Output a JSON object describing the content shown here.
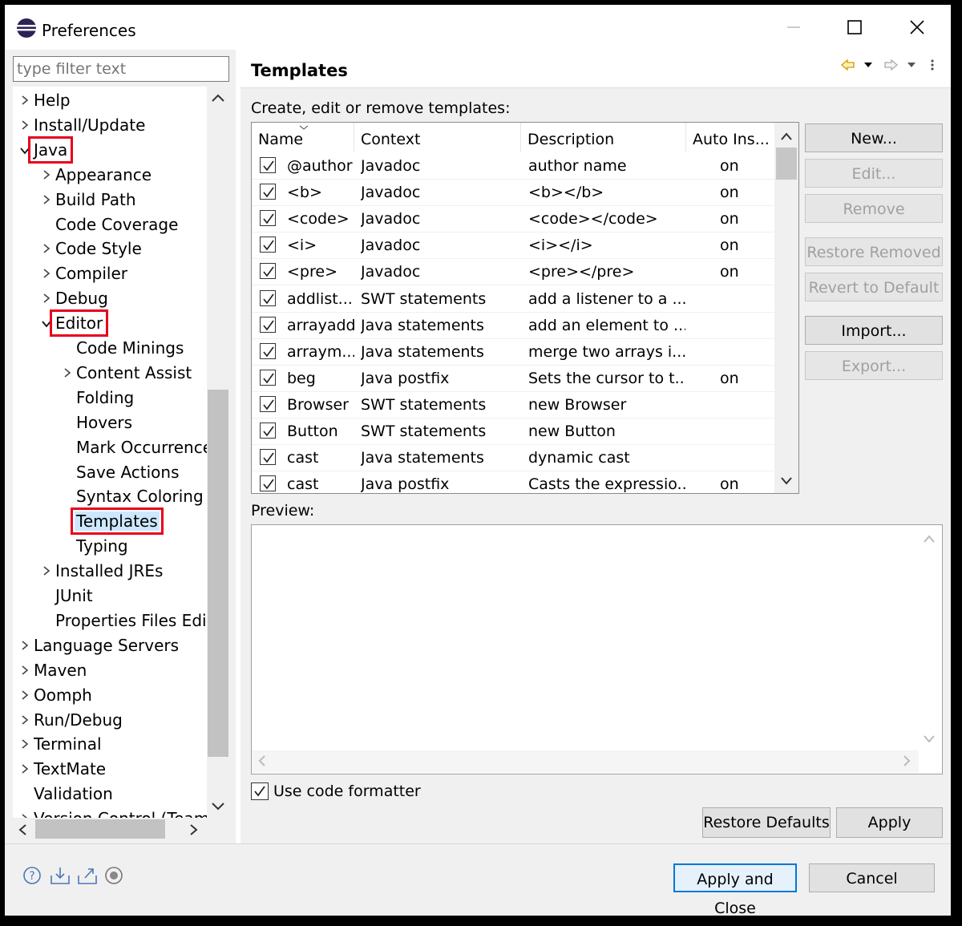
{
  "window": {
    "title": "Preferences"
  },
  "filter": {
    "placeholder": "type filter text"
  },
  "tree": [
    {
      "label": "Help",
      "level": 0,
      "arrow": ">"
    },
    {
      "label": "Install/Update",
      "level": 0,
      "arrow": ">"
    },
    {
      "label": "Java",
      "level": 0,
      "arrow": "v",
      "highlight": true
    },
    {
      "label": "Appearance",
      "level": 1,
      "arrow": ">"
    },
    {
      "label": "Build Path",
      "level": 1,
      "arrow": ">"
    },
    {
      "label": "Code Coverage",
      "level": 1,
      "arrow": ""
    },
    {
      "label": "Code Style",
      "level": 1,
      "arrow": ">"
    },
    {
      "label": "Compiler",
      "level": 1,
      "arrow": ">"
    },
    {
      "label": "Debug",
      "level": 1,
      "arrow": ">"
    },
    {
      "label": "Editor",
      "level": 1,
      "arrow": "v",
      "highlight": true
    },
    {
      "label": "Code Minings",
      "level": 2,
      "arrow": ""
    },
    {
      "label": "Content Assist",
      "level": 2,
      "arrow": ">"
    },
    {
      "label": "Folding",
      "level": 2,
      "arrow": ""
    },
    {
      "label": "Hovers",
      "level": 2,
      "arrow": ""
    },
    {
      "label": "Mark Occurrences",
      "level": 2,
      "arrow": ""
    },
    {
      "label": "Save Actions",
      "level": 2,
      "arrow": ""
    },
    {
      "label": "Syntax Coloring",
      "level": 2,
      "arrow": ""
    },
    {
      "label": "Templates",
      "level": 2,
      "arrow": "",
      "highlight": true,
      "selected": true
    },
    {
      "label": "Typing",
      "level": 2,
      "arrow": ""
    },
    {
      "label": "Installed JREs",
      "level": 1,
      "arrow": ">"
    },
    {
      "label": "JUnit",
      "level": 1,
      "arrow": ""
    },
    {
      "label": "Properties Files Editor",
      "level": 1,
      "arrow": ""
    },
    {
      "label": "Language Servers",
      "level": 0,
      "arrow": ">"
    },
    {
      "label": "Maven",
      "level": 0,
      "arrow": ">"
    },
    {
      "label": "Oomph",
      "level": 0,
      "arrow": ">"
    },
    {
      "label": "Run/Debug",
      "level": 0,
      "arrow": ">"
    },
    {
      "label": "Terminal",
      "level": 0,
      "arrow": ">"
    },
    {
      "label": "TextMate",
      "level": 0,
      "arrow": ">"
    },
    {
      "label": "Validation",
      "level": 0,
      "arrow": ""
    },
    {
      "label": "Version Control (Team)",
      "level": 0,
      "arrow": ">"
    }
  ],
  "main": {
    "title": "Templates",
    "description": "Create, edit or remove templates:",
    "columns": [
      "Name",
      "Context",
      "Description",
      "Auto Ins..."
    ],
    "rows": [
      {
        "name": "@author",
        "context": "Javadoc",
        "description": "author name",
        "auto": "on"
      },
      {
        "name": "<b>",
        "context": "Javadoc",
        "description": "<b></b>",
        "auto": "on"
      },
      {
        "name": "<code>",
        "context": "Javadoc",
        "description": "<code></code>",
        "auto": "on"
      },
      {
        "name": "<i>",
        "context": "Javadoc",
        "description": "<i></i>",
        "auto": "on"
      },
      {
        "name": "<pre>",
        "context": "Javadoc",
        "description": "<pre></pre>",
        "auto": "on"
      },
      {
        "name": "addlist...",
        "context": "SWT statements",
        "description": "add a listener to a ...",
        "auto": ""
      },
      {
        "name": "arrayadd",
        "context": "Java statements",
        "description": "add an element to ...",
        "auto": ""
      },
      {
        "name": "arraym...",
        "context": "Java statements",
        "description": "merge two arrays i...",
        "auto": ""
      },
      {
        "name": "beg",
        "context": "Java postfix",
        "description": "Sets the cursor to t...",
        "auto": "on"
      },
      {
        "name": "Browser",
        "context": "SWT statements",
        "description": "new Browser",
        "auto": ""
      },
      {
        "name": "Button",
        "context": "SWT statements",
        "description": "new Button",
        "auto": ""
      },
      {
        "name": "cast",
        "context": "Java statements",
        "description": "dynamic cast",
        "auto": ""
      },
      {
        "name": "cast",
        "context": "Java postfix",
        "description": "Casts the expressio...",
        "auto": "on"
      }
    ],
    "buttons": {
      "new": "New...",
      "edit": "Edit...",
      "remove": "Remove",
      "restore_removed": "Restore Removed",
      "revert": "Revert to Default",
      "import": "Import...",
      "export": "Export..."
    },
    "preview_label": "Preview:",
    "use_formatter": "Use code formatter",
    "restore_defaults": "Restore Defaults",
    "apply": "Apply"
  },
  "footer": {
    "apply_close": "Apply and Close",
    "cancel": "Cancel"
  },
  "colors": {
    "highlight": "#e8001c",
    "selected_bg": "#cce8ff",
    "accent": "#0078d7"
  }
}
